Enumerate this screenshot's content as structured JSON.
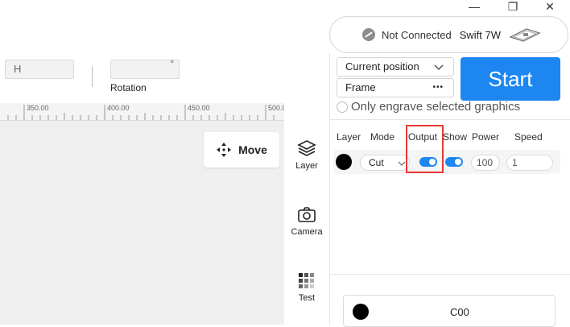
{
  "window_controls": {
    "minimize": "—",
    "restore": "❐",
    "close": "✕"
  },
  "connection": {
    "status": "Not Connected",
    "device": "Swift 7W"
  },
  "toolbar": {
    "h_placeholder": "H",
    "degree_symbol": "°",
    "rotation_label": "Rotation"
  },
  "ruler": {
    "labels": [
      "350.00",
      "400.00",
      "450.00",
      "500.00"
    ]
  },
  "canvas": {
    "move_label": "Move"
  },
  "tabs": [
    {
      "label": "Layer"
    },
    {
      "label": "Camera"
    },
    {
      "label": "Test"
    }
  ],
  "panel": {
    "position_select": "Current position",
    "frame_select": "Frame",
    "frame_more": "•••",
    "start_label": "Start",
    "only_engrave_label": "Only engrave selected graphics",
    "columns": {
      "layer": "Layer",
      "mode": "Mode",
      "output": "Output",
      "show": "Show",
      "power": "Power",
      "speed": "Speed"
    },
    "layer_row": {
      "mode": "Cut",
      "power": "100",
      "speed": "1",
      "color": "#000000",
      "output_on": true,
      "show_on": true
    },
    "bottom_item": {
      "label": "C00",
      "color": "#000000"
    }
  },
  "colors": {
    "accent": "#1e86f0",
    "highlight": "#e53935"
  }
}
